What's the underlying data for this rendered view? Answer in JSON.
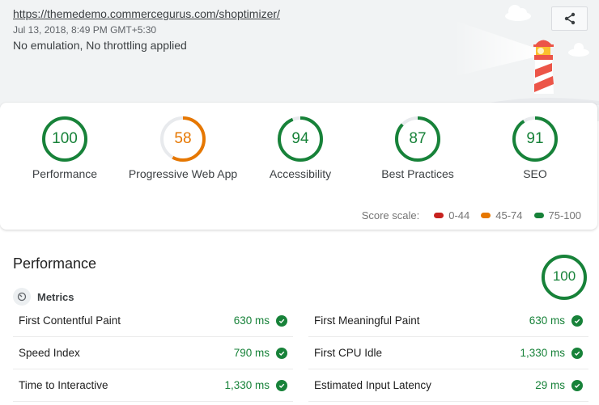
{
  "header": {
    "url": "https://themedemo.commercegurus.com/shoptimizer/",
    "date": "Jul 13, 2018, 8:49 PM GMT+5:30",
    "environment": "No emulation, No throttling applied",
    "share_icon": "share-icon",
    "illustration": "lighthouse-illustration"
  },
  "colors": {
    "pass": "#178239",
    "average": "#e67700",
    "fail": "#c7221f",
    "track": "#e8eaed"
  },
  "scores": [
    {
      "label": "Performance",
      "score": 100,
      "rating": "pass"
    },
    {
      "label": "Progressive Web App",
      "score": 58,
      "rating": "average"
    },
    {
      "label": "Accessibility",
      "score": 94,
      "rating": "pass"
    },
    {
      "label": "Best Practices",
      "score": 87,
      "rating": "pass"
    },
    {
      "label": "SEO",
      "score": 91,
      "rating": "pass"
    }
  ],
  "scale": {
    "label": "Score scale:",
    "ranges": [
      {
        "label": "0-44",
        "rating": "fail"
      },
      {
        "label": "45-74",
        "rating": "average"
      },
      {
        "label": "75-100",
        "rating": "pass"
      }
    ]
  },
  "performance": {
    "title": "Performance",
    "score": "100",
    "score_value": 100,
    "metrics_label": "Metrics",
    "metrics_icon": "timer-icon",
    "metrics": [
      {
        "name": "First Contentful Paint",
        "value": "630 ms",
        "status": "pass"
      },
      {
        "name": "First Meaningful Paint",
        "value": "630 ms",
        "status": "pass"
      },
      {
        "name": "Speed Index",
        "value": "790 ms",
        "status": "pass"
      },
      {
        "name": "First CPU Idle",
        "value": "1,330 ms",
        "status": "pass"
      },
      {
        "name": "Time to Interactive",
        "value": "1,330 ms",
        "status": "pass"
      },
      {
        "name": "Estimated Input Latency",
        "value": "29 ms",
        "status": "pass"
      }
    ]
  }
}
